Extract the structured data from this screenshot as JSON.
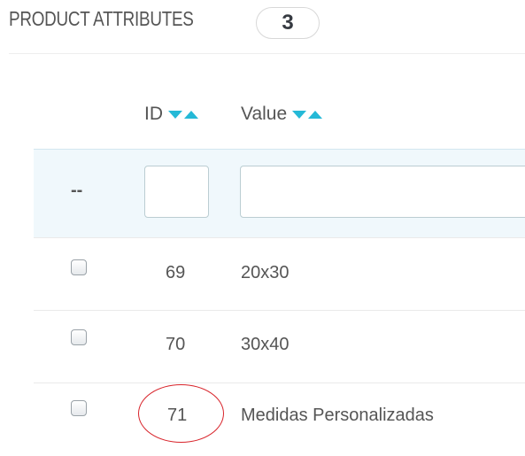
{
  "panel": {
    "title": "PRODUCT ATTRIBUTES",
    "count": "3"
  },
  "table": {
    "columns": [
      {
        "label": "ID",
        "sortable": true
      },
      {
        "label": "Value",
        "sortable": true
      }
    ],
    "filter": {
      "placeholder_label": "--",
      "id_value": "",
      "value_value": ""
    },
    "rows": [
      {
        "id": "69",
        "value": "20x30",
        "checked": false
      },
      {
        "id": "70",
        "value": "30x40",
        "checked": false
      },
      {
        "id": "71",
        "value": "Medidas Personalizadas",
        "checked": false,
        "highlighted": true
      }
    ]
  },
  "colors": {
    "accent": "#25b9d7",
    "filter_bg": "#f0f8fc",
    "highlight": "#d8232a"
  }
}
